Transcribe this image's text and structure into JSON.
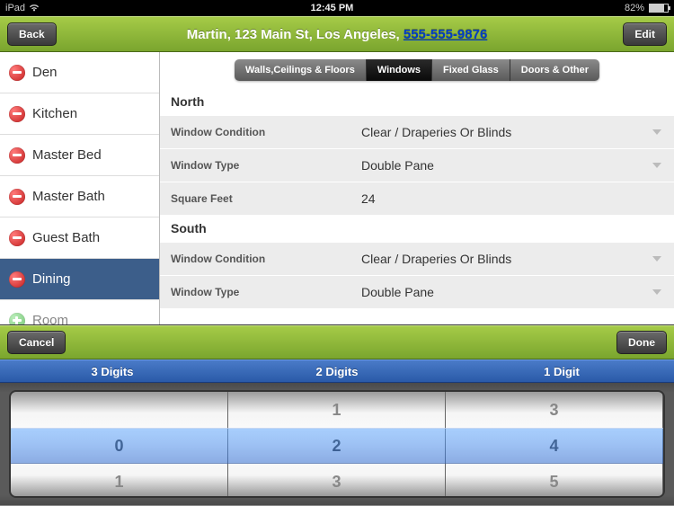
{
  "status": {
    "device": "iPad",
    "time": "12:45 PM",
    "battery": "82%"
  },
  "header": {
    "back": "Back",
    "edit": "Edit",
    "title_prefix": "Martin, 123 Main St, Los Angeles, ",
    "phone": "555-555-9876"
  },
  "sidebar": {
    "items": [
      {
        "label": "Den",
        "icon": "minus"
      },
      {
        "label": "Kitchen",
        "icon": "minus"
      },
      {
        "label": "Master Bed",
        "icon": "minus"
      },
      {
        "label": "Master Bath",
        "icon": "minus"
      },
      {
        "label": "Guest Bath",
        "icon": "minus"
      },
      {
        "label": "Dining",
        "icon": "minus",
        "selected": true
      },
      {
        "label": "Room",
        "icon": "plus"
      }
    ]
  },
  "tabs": [
    "Walls,Ceilings & Floors",
    "Windows",
    "Fixed Glass",
    "Doors & Other"
  ],
  "activeTab": 1,
  "sections": [
    {
      "title": "North",
      "rows": [
        {
          "label": "Window Condition",
          "value": "Clear / Draperies Or  Blinds"
        },
        {
          "label": "Window Type",
          "value": "Double Pane"
        },
        {
          "label": "Square Feet",
          "value": "24"
        }
      ]
    },
    {
      "title": "South",
      "rows": [
        {
          "label": "Window Condition",
          "value": "Clear / Draperies Or  Blinds"
        },
        {
          "label": "Window Type",
          "value": "Double Pane"
        }
      ]
    }
  ],
  "picker": {
    "cancel": "Cancel",
    "done": "Done",
    "cols": [
      "3 Digits",
      "2 Digits",
      "1 Digit"
    ],
    "wheels": [
      [
        "",
        "0",
        "1"
      ],
      [
        "1",
        "2",
        "3"
      ],
      [
        "3",
        "4",
        "5"
      ]
    ]
  }
}
